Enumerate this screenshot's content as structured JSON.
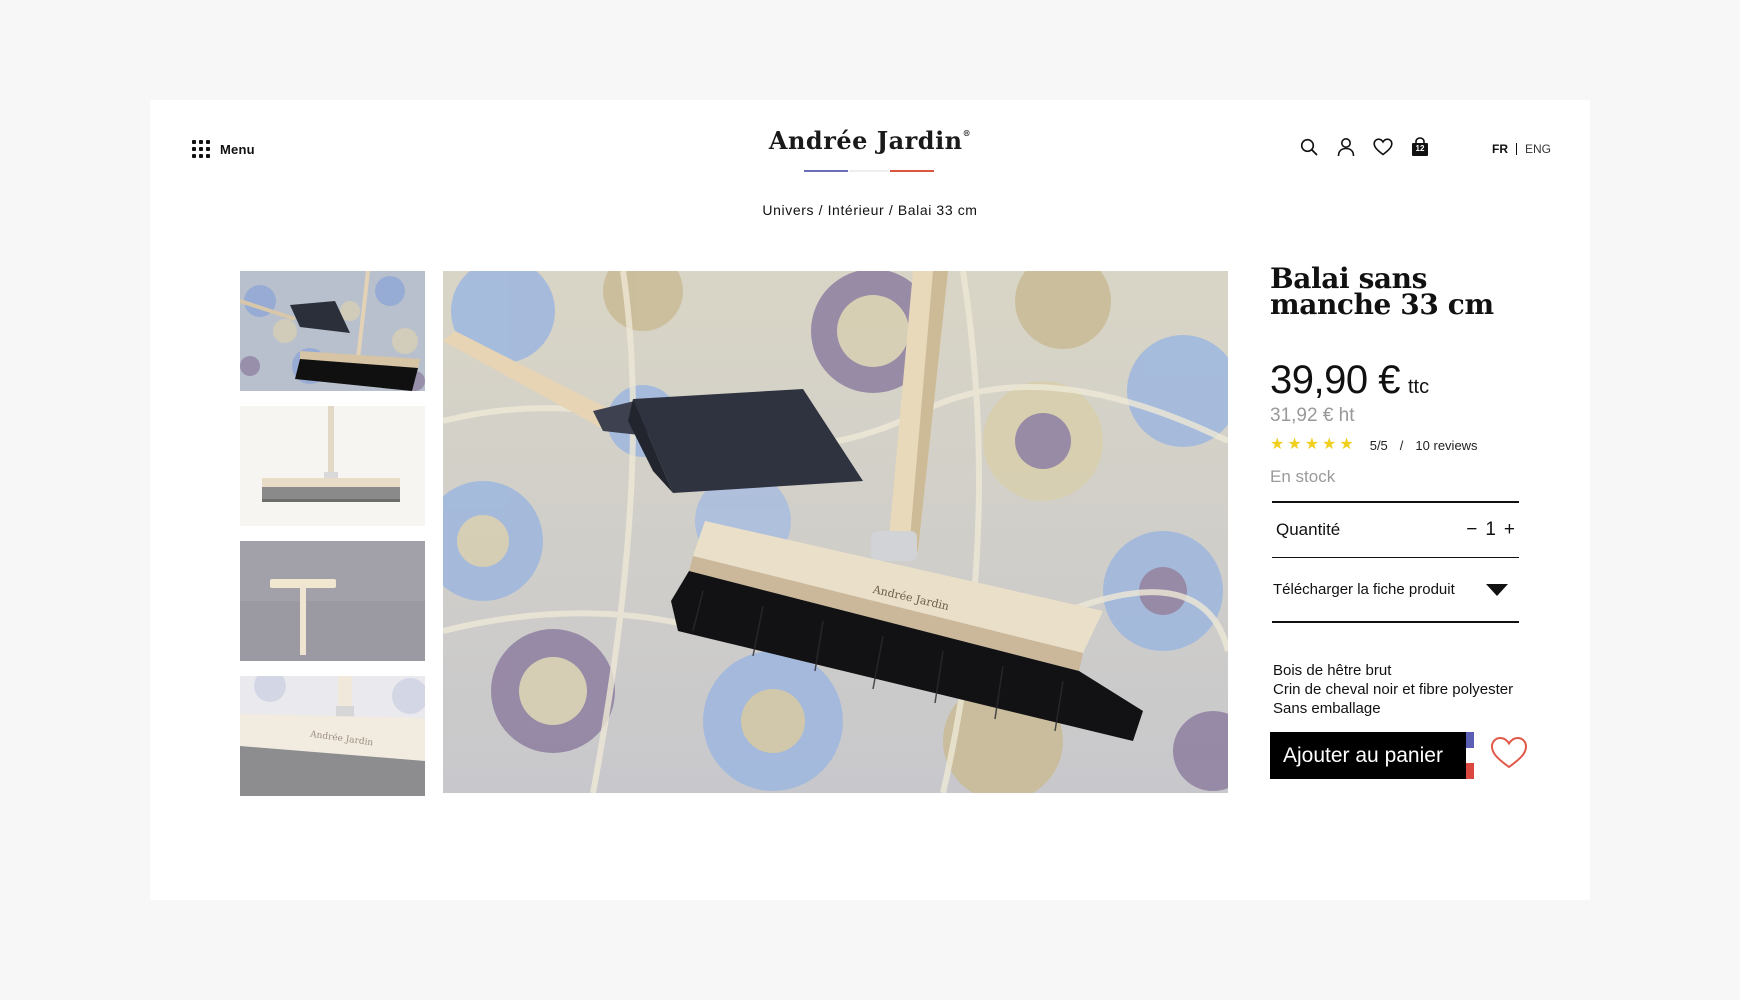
{
  "header": {
    "menu_label": "Menu",
    "logo_text": "Andrée Jardin",
    "logo_mark": "®",
    "icons": [
      "search-icon",
      "user-icon",
      "heart-icon",
      "bag-icon"
    ],
    "cart_count": "12",
    "lang_fr": "FR",
    "lang_en": "ENG"
  },
  "breadcrumb": {
    "items": [
      "Univers",
      "Intérieur",
      "Balai 33 cm"
    ],
    "separator": " / "
  },
  "product": {
    "title": "Balai sans manche 33 cm",
    "price_ttc": "39,90 €",
    "ttc_label": "ttc",
    "price_ht": "31,92 € ht",
    "rating_value": "5/5",
    "rating_slash": "/",
    "reviews": "10 reviews",
    "stars": 5,
    "stock": "En stock",
    "quantity_label": "Quantité",
    "quantity_minus": "−",
    "quantity": "1",
    "quantity_plus": "+",
    "download_label": "Télécharger la fiche produit",
    "features": [
      "Bois de hêtre brut",
      "Crin de cheval noir et fibre polyester",
      "Sans emballage"
    ],
    "add_to_cart": "Ajouter au panier"
  },
  "colors": {
    "flag_blue": "#5a5fb3",
    "flag_white": "#ffffff",
    "flag_red": "#d9473f",
    "star": "#f0cf1e",
    "wishlist_heart": "#e05848"
  }
}
